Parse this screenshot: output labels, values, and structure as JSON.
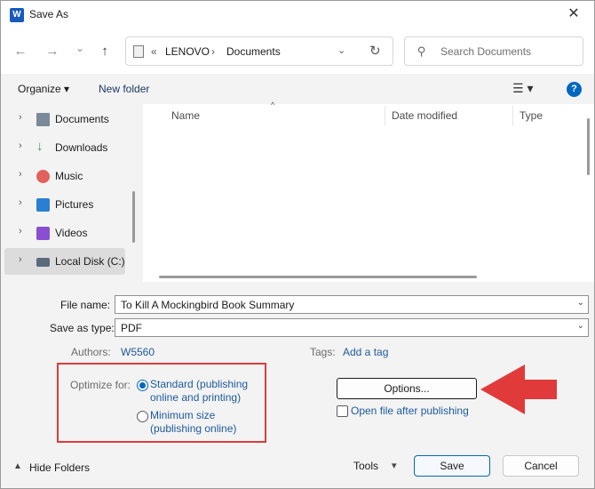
{
  "window": {
    "title": "Save As",
    "app_icon": "W",
    "close_glyph": "✕"
  },
  "nav": {
    "back_glyph": "←",
    "forward_glyph": "→",
    "recent_glyph": "⌄",
    "up_glyph": "↑",
    "breadcrumb_prefix": "«",
    "breadcrumb": [
      "LENOVO",
      "Documents"
    ],
    "breadcrumb_sep": "›",
    "dropdown_glyph": "⌄",
    "refresh_glyph": "↻",
    "search_placeholder": "Search Documents"
  },
  "toolbar": {
    "organize_label": "Organize ▾",
    "new_folder_label": "New folder",
    "view_glyph": "☰ ▾",
    "help_glyph": "?"
  },
  "sidebar": {
    "items": [
      {
        "label": "Documents",
        "icon": "documents-icon",
        "color": "#6b7b8c"
      },
      {
        "label": "Downloads",
        "icon": "downloads-icon",
        "color": "#2e9e4f"
      },
      {
        "label": "Music",
        "icon": "music-icon",
        "color": "#d9534f"
      },
      {
        "label": "Pictures",
        "icon": "pictures-icon",
        "color": "#2a7fd4"
      },
      {
        "label": "Videos",
        "icon": "videos-icon",
        "color": "#8a4fd1"
      },
      {
        "label": "Local Disk (C:)",
        "icon": "disk-icon",
        "color": "#5a6b7c"
      }
    ],
    "chevron_glyph": "›"
  },
  "filelist": {
    "columns": [
      "Name",
      "Date modified",
      "Type"
    ],
    "sort_glyph": "^"
  },
  "form": {
    "file_name_label": "File name:",
    "file_name_value": "To Kill A Mockingbird Book Summary",
    "save_type_label": "Save as type:",
    "save_type_value": "PDF",
    "authors_label": "Authors:",
    "authors_value": "W5560",
    "tags_label": "Tags:",
    "tags_value": "Add a tag",
    "optimize_label": "Optimize for:",
    "optimize_standard": "Standard (publishing online and printing)",
    "optimize_minimum": "Minimum size (publishing online)",
    "options_label": "Options...",
    "open_after_label": "Open file after publishing"
  },
  "footer": {
    "hide_folders_label": "Hide Folders",
    "hide_glyph": "▲",
    "tools_label": "Tools",
    "tools_glyph": "▾",
    "save_label": "Save",
    "cancel_label": "Cancel"
  },
  "colors": {
    "accent": "#0067c0",
    "annotation": "#e03a3a"
  }
}
